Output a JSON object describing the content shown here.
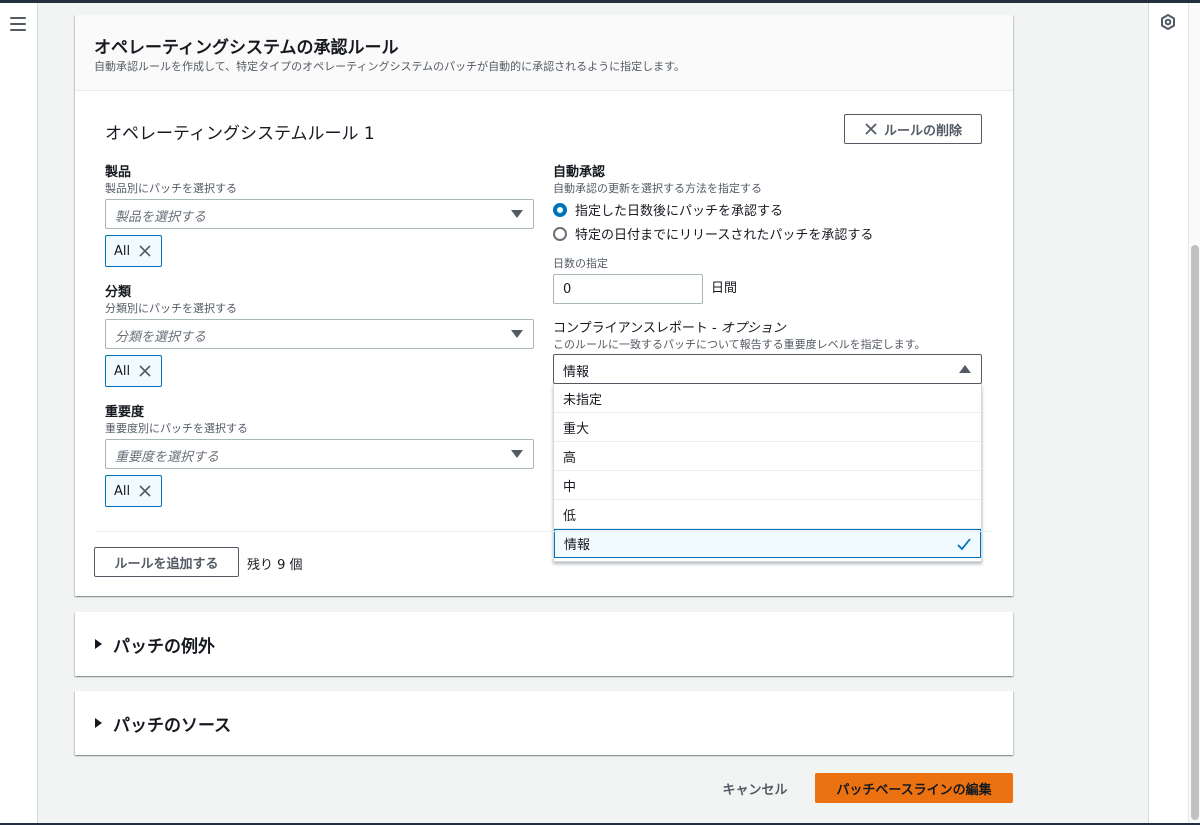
{
  "approval_panel": {
    "title": "オペレーティングシステムの承認ルール",
    "description": "自動承認ルールを作成して、特定タイプのオペレーティングシステムのパッチが自動的に承認されるように指定します。"
  },
  "rule": {
    "title": "オペレーティングシステムルール 1",
    "delete_label": "ルールの削除",
    "product": {
      "label": "製品",
      "description": "製品別にパッチを選択する",
      "placeholder": "製品を選択する",
      "token": "All"
    },
    "classification": {
      "label": "分類",
      "description": "分類別にパッチを選択する",
      "placeholder": "分類を選択する",
      "token": "All"
    },
    "severity": {
      "label": "重要度",
      "description": "重要度別にパッチを選択する",
      "placeholder": "重要度を選択する",
      "token": "All"
    },
    "auto_approval": {
      "label": "自動承認",
      "description": "自動承認の更新を選択する方法を指定する",
      "options": [
        {
          "label": "指定した日数後にパッチを承認する",
          "checked": true
        },
        {
          "label": "特定の日付までにリリースされたパッチを承認する",
          "checked": false
        }
      ],
      "days_label": "日数の指定",
      "days_value": "0",
      "days_unit": "日間"
    },
    "compliance": {
      "label": "コンプライアンスレポート - ",
      "label_optional": "オプション",
      "description": "このルールに一致するパッチについて報告する重要度レベルを指定します。",
      "selected": "情報",
      "options": [
        "未指定",
        "重大",
        "高",
        "中",
        "低",
        "情報"
      ]
    }
  },
  "footer": {
    "add_rule_label": "ルールを追加する",
    "remaining": "残り 9 個"
  },
  "sections": {
    "exceptions_title": "パッチの例外",
    "sources_title": "パッチのソース"
  },
  "actions": {
    "cancel_label": "キャンセル",
    "submit_label": "パッチベースラインの編集"
  },
  "colors": {
    "accent": "#0073bb",
    "primary_button": "#ec7211"
  }
}
